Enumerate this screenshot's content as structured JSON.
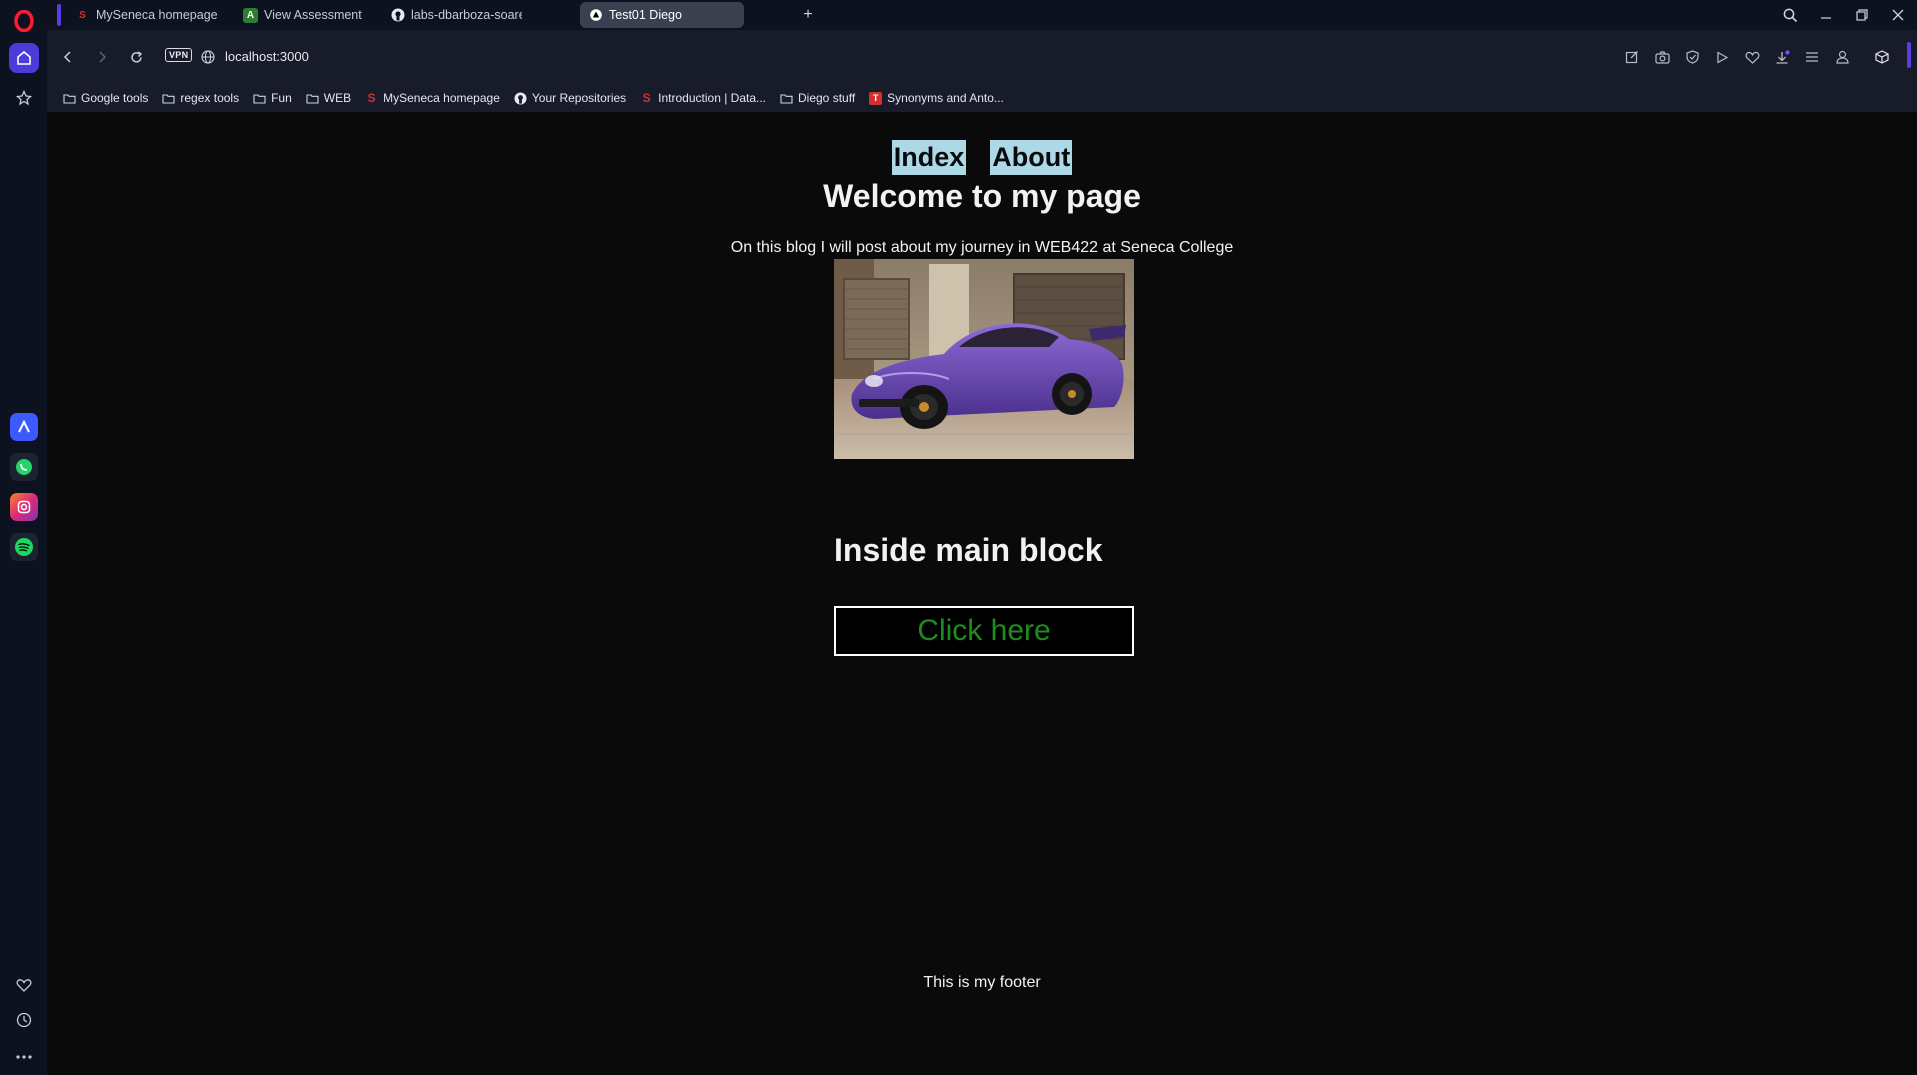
{
  "browser": {
    "tabs": [
      {
        "title": "MySeneca homepage",
        "active": false
      },
      {
        "title": "View Assessment",
        "active": false
      },
      {
        "title": "labs-dbarboza-soares/lab",
        "active": false
      },
      {
        "title": "Test01 Diego",
        "active": true
      }
    ],
    "vpn_label": "VPN",
    "url": "localhost:3000",
    "bookmarks": [
      {
        "label": "Google tools",
        "icon": "folder-icon"
      },
      {
        "label": "regex tools",
        "icon": "folder-icon"
      },
      {
        "label": "Fun",
        "icon": "folder-icon"
      },
      {
        "label": "WEB",
        "icon": "folder-icon"
      },
      {
        "label": "MySeneca homepage",
        "icon": "seneca-icon"
      },
      {
        "label": "Your Repositories",
        "icon": "github-icon"
      },
      {
        "label": "Introduction | Data...",
        "icon": "seneca-icon"
      },
      {
        "label": "Diego stuff",
        "icon": "folder-icon"
      },
      {
        "label": "Synonyms and Anto...",
        "icon": "thesaurus-icon"
      }
    ],
    "colors": {
      "sidebar_bg": "#0d1221",
      "toolbar_bg": "#181c2a",
      "accent": "#4b3bd8",
      "opera_red": "#ff1b2d"
    }
  },
  "site": {
    "nav": [
      {
        "label": "Index"
      },
      {
        "label": "About"
      }
    ],
    "heading": "Welcome to my page",
    "intro": "On this blog I will post about my journey in WEB422 at Seneca College",
    "image_subject": "purple sports car",
    "main_heading": "Inside main block",
    "button_label": "Click here",
    "footer": "This is my footer",
    "colors": {
      "page_bg": "#0a0a0a",
      "nav_bg": "#add8e6",
      "button_text": "#1e8c1e"
    }
  }
}
